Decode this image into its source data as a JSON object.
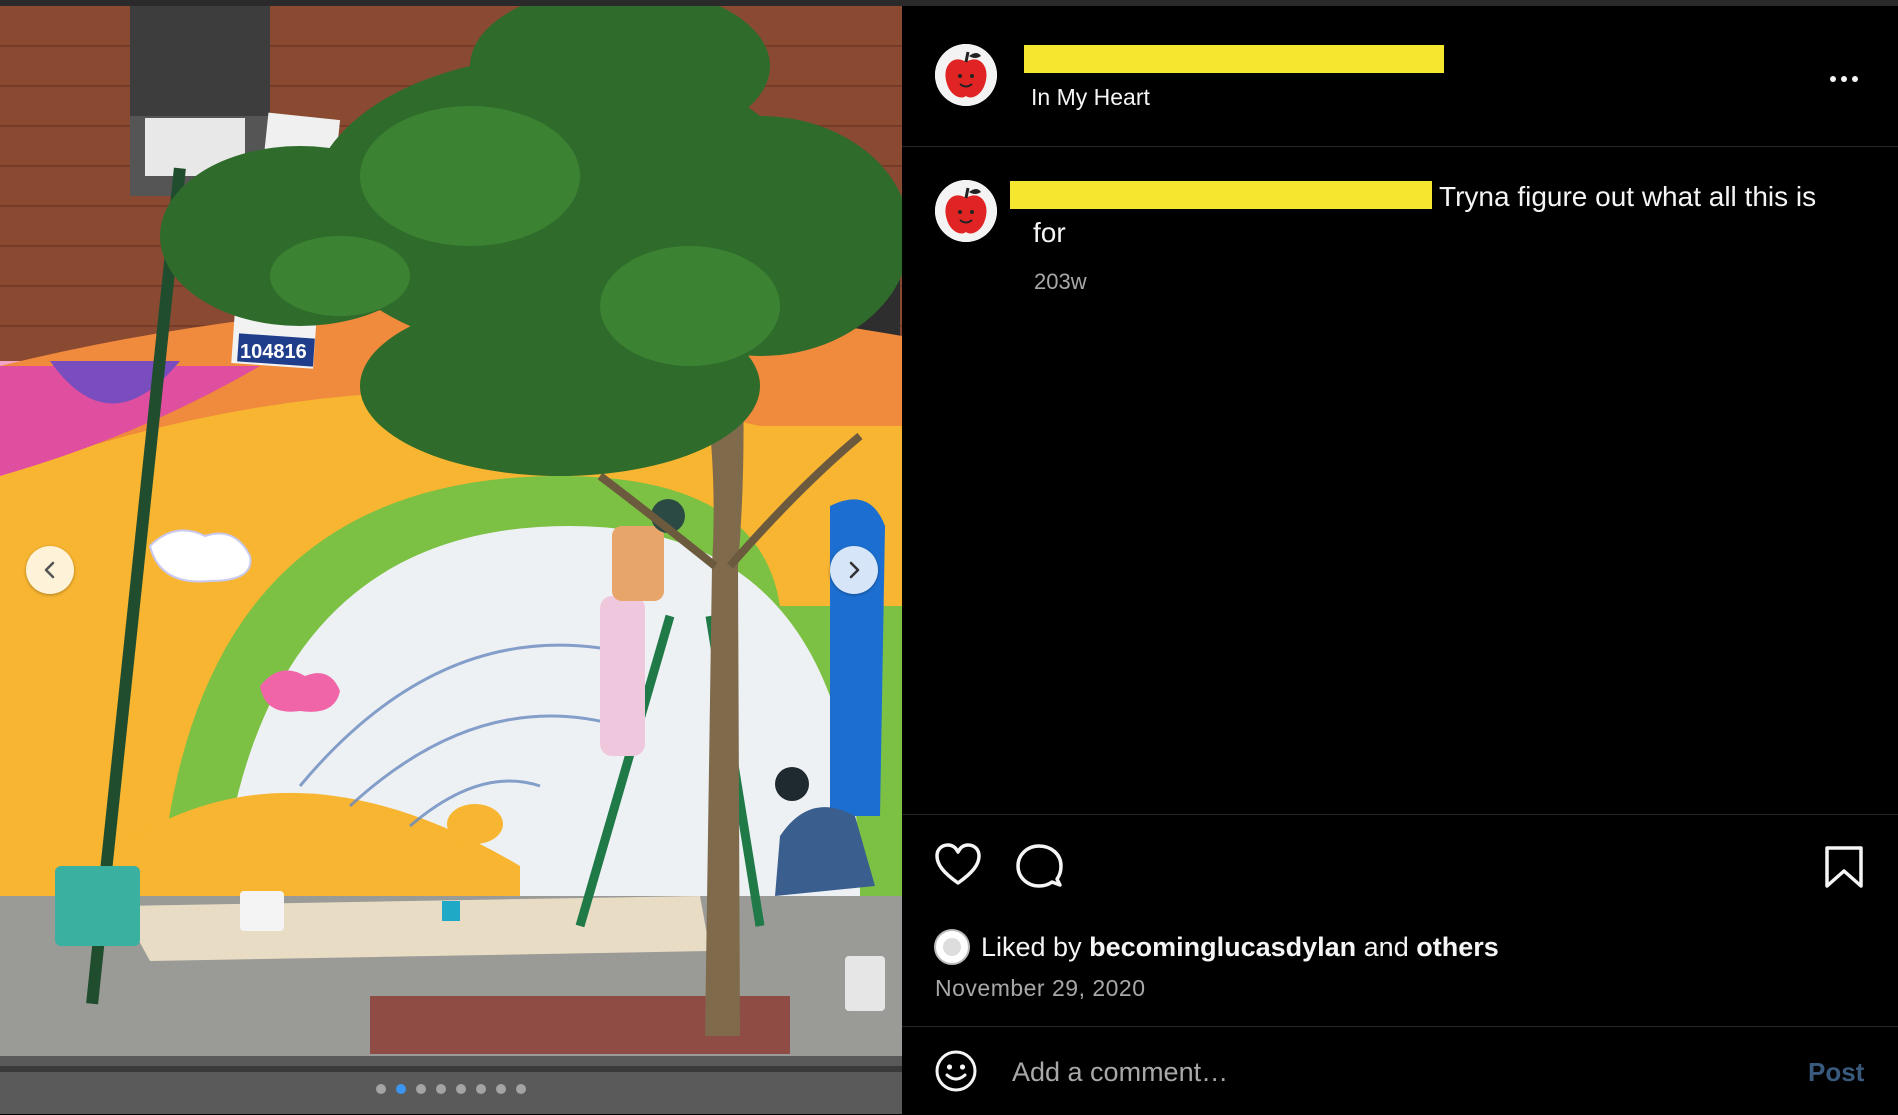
{
  "post": {
    "location": "In My Heart",
    "caption_text": "Tryna figure out what all this is",
    "caption_text_cont": "for",
    "caption_time": "203w",
    "liked_prefix": "Liked by ",
    "liked_user": "becominglucasdylan",
    "liked_and": " and ",
    "liked_others": "others",
    "date": "November 29, 2020",
    "comment_placeholder": "Add a comment…",
    "post_label": "Post"
  },
  "media": {
    "sign_zone": "104816",
    "carousel_total": 8,
    "carousel_active": 2
  },
  "colors": {
    "redaction": "#f5e62f",
    "dot_active": "#3b94f0",
    "post_button": "#3a5a7d",
    "meta_text": "#a8a8a8"
  }
}
